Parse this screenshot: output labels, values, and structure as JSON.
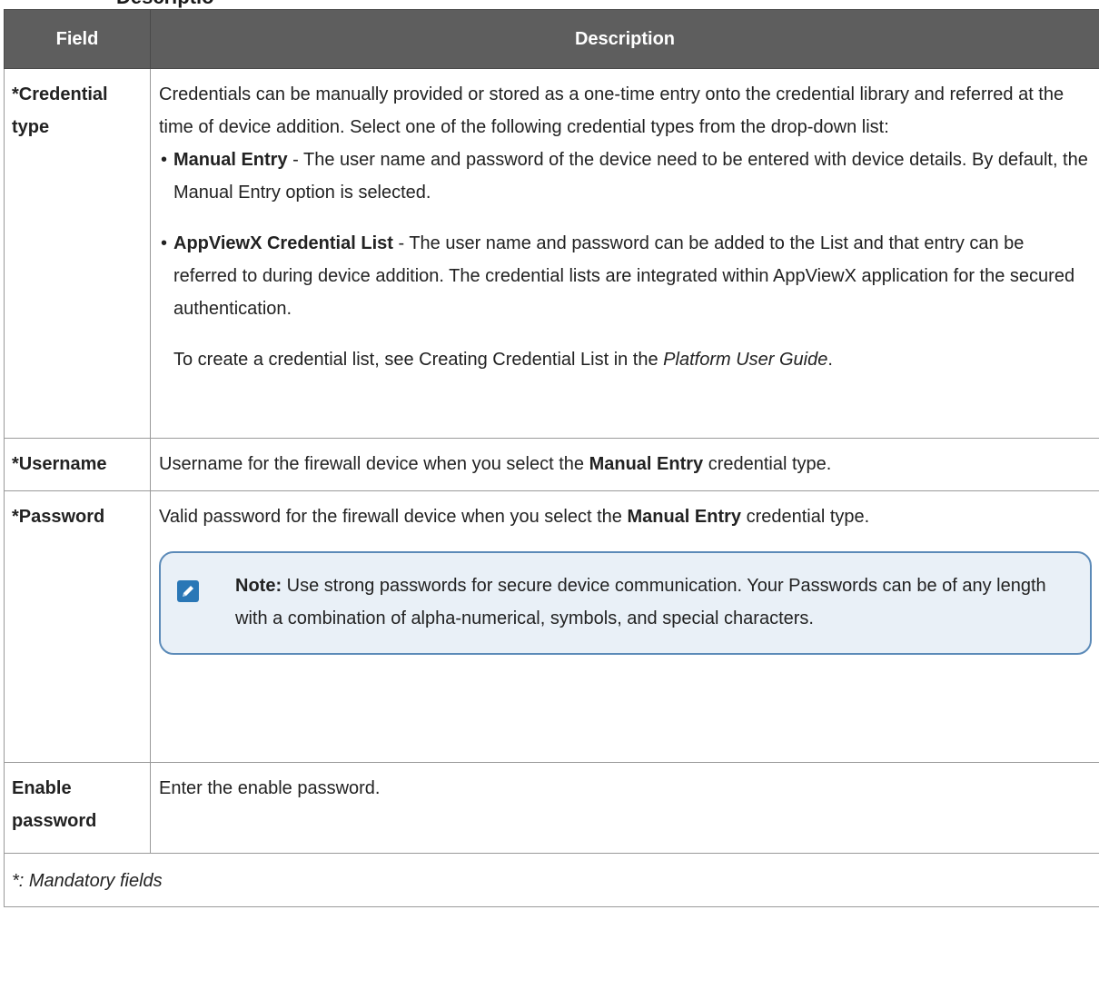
{
  "heading": "Descriptio",
  "table": {
    "headers": [
      "Field",
      "Description"
    ],
    "rows": [
      {
        "field": "*Credential type",
        "intro": "Credentials can be manually provided or stored as a one-time entry onto the credential library and referred at the time of device addition. Select one of the following credential types from the drop-down list:",
        "options": [
          {
            "bullet": "•",
            "name": "Manual Entry",
            "text": " - The user name and password of the device need to be entered with device details. By default, the Manual Entry option is selected."
          },
          {
            "bullet": "•",
            "name": "AppViewX Credential List",
            "text": " - The user name and password can be added to the List and that entry can be referred to during device addition. The credential lists are integrated within AppViewX application for the secured authentication."
          }
        ],
        "extra_prefix": "To create a credential list, see Creating Credential List in the ",
        "extra_guide": "Platform User Guide",
        "extra_suffix": "."
      },
      {
        "field": "*Username",
        "prefix": "Username for the firewall device when you select the ",
        "bold": "Manual Entry",
        "suffix": " credential type."
      },
      {
        "field": "*Password",
        "prefix": "Valid password for the firewall device when you select the ",
        "bold": "Manual Entry",
        "suffix": " credential type.",
        "note": {
          "icon": "pencil-icon",
          "label": "Note:",
          "text": " Use strong passwords for secure device communication. Your Passwords can be of any length with a combination of alpha-numerical, symbols, and special characters."
        }
      },
      {
        "field": "Enable password",
        "desc": "Enter the enable password."
      }
    ],
    "footer": "*: Mandatory fields"
  }
}
